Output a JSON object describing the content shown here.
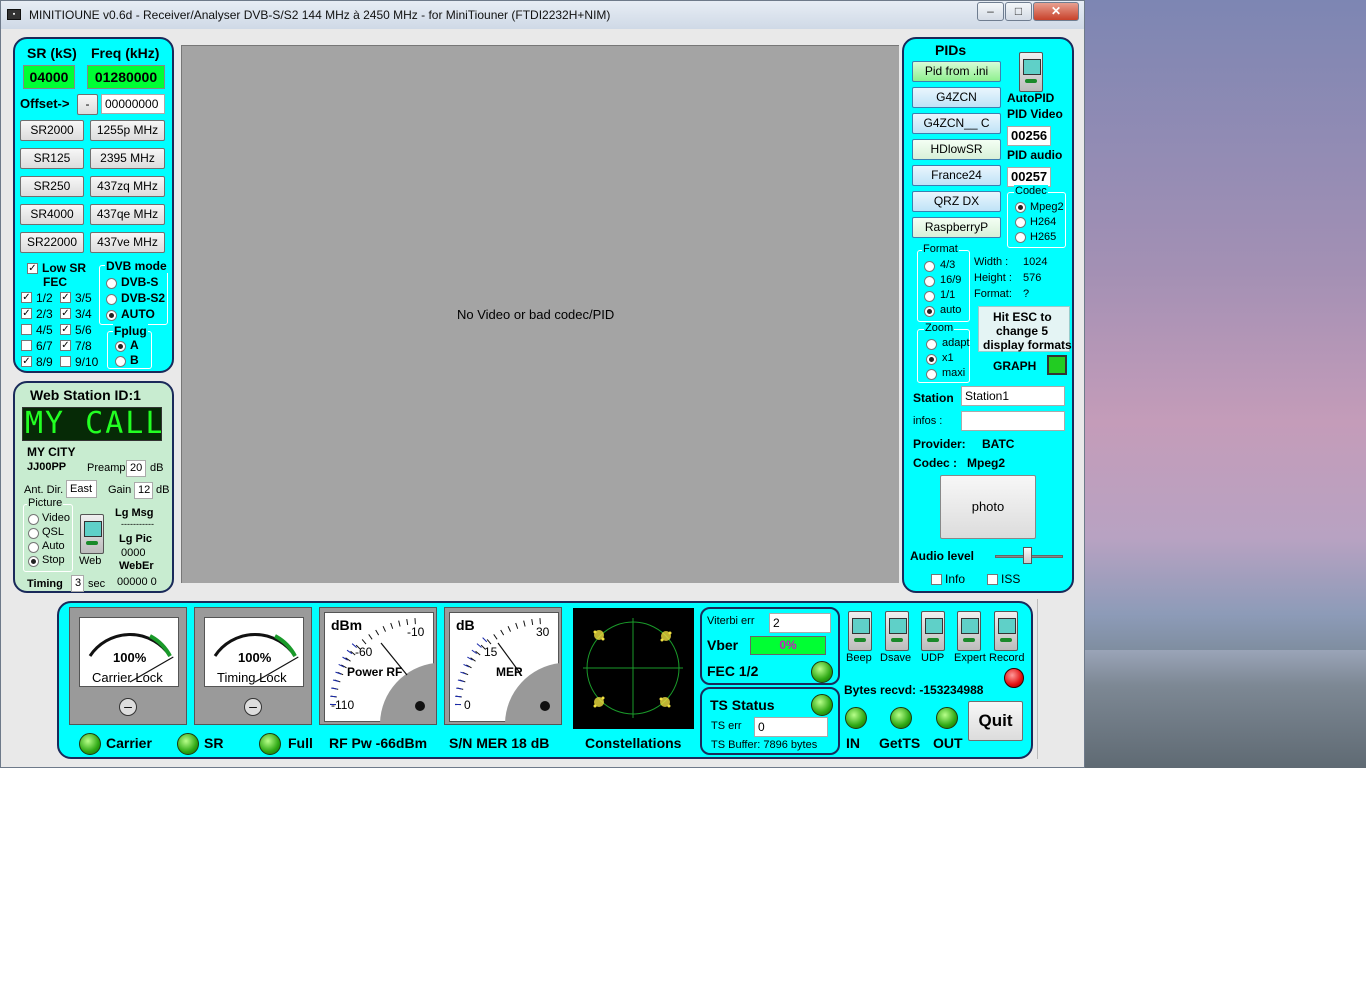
{
  "window": {
    "title": "MINITIOUNE v0.6d - Receiver/Analyser DVB-S/S2 144 MHz à 2450 MHz - for MiniTiouner (FTDI2232H+NIM)"
  },
  "left": {
    "sr_label": "SR (kS)",
    "freq_label": "Freq (kHz)",
    "sr_value": "04000",
    "freq_value": "01280000",
    "offset_label": "Offset->",
    "offset_sign": "-",
    "offset_value": "00000000",
    "sr_buttons": [
      "SR2000",
      "SR125",
      "SR250",
      "SR4000",
      "SR22000"
    ],
    "freq_buttons": [
      "1255p MHz",
      "2395 MHz",
      "437zq MHz",
      "437qe MHz",
      "437ve MHz"
    ],
    "low_sr": "Low SR",
    "fec_label": "FEC",
    "fec": [
      "1/2",
      "3/5",
      "2/3",
      "3/4",
      "4/5",
      "5/6",
      "6/7",
      "7/8",
      "8/9",
      "9/10"
    ],
    "dvb_mode_label": "DVB mode",
    "dvb_modes": [
      "DVB-S",
      "DVB-S2",
      "AUTO"
    ],
    "fplug_label": "Fplug",
    "fplug": [
      "A",
      "B"
    ]
  },
  "web": {
    "title": "Web Station ID:1",
    "lcd": "MY CALL",
    "city": "MY CITY",
    "locator": "JJ00PP",
    "preamp_label": "Preamp",
    "preamp_value": "20",
    "db1": "dB",
    "antdir_label": "Ant. Dir.",
    "antdir_value": "East",
    "gain_label": "Gain",
    "gain_value": "12",
    "db2": "dB",
    "picture_label": "Picture",
    "picture_opts": [
      "Video",
      "QSL",
      "Auto",
      "Stop"
    ],
    "lg_msg": "Lg Msg",
    "dashes": "-----------",
    "lg_pic": "Lg Pic",
    "lg_pic_value": "0000",
    "web_label": "Web",
    "weber_label": "WebEr",
    "weber_value": "00000  0",
    "timing_label": "Timing",
    "timing_value": "3",
    "sec": "sec"
  },
  "video": {
    "message": "No Video or bad codec/PID"
  },
  "pids": {
    "title": "PIDs",
    "buttons": [
      "Pid from .ini",
      "G4ZCN",
      "G4ZCN__ C",
      "HDlowSR",
      "France24",
      "QRZ DX",
      "RaspberryP"
    ],
    "autopid": "AutoPID",
    "pid_video_label": "PID Video",
    "pid_video": "00256",
    "pid_audio_label": "PID audio",
    "pid_audio": "00257",
    "codec_label": "Codec",
    "codecs": [
      "Mpeg2",
      "H264",
      "H265"
    ],
    "format_label": "Format",
    "formats": [
      "4/3",
      "16/9",
      "1/1",
      "auto"
    ],
    "width_label": "Width :",
    "width_value": "1024",
    "height_label": "Height :",
    "height_value": "576",
    "format_info_label": "Format:",
    "format_info_value": "?",
    "zoom_label": "Zoom",
    "zooms": [
      "adapt",
      "x1",
      "maxi"
    ],
    "esc_hint": [
      "Hit ESC to",
      "change  5",
      "display formats"
    ],
    "graph": "GRAPH",
    "station_label": "Station",
    "station_value": "Station1",
    "infos_label": "infos :",
    "infos_value": "",
    "provider_label": "Provider:",
    "provider_value": "BATC",
    "codec_info_label": "Codec :",
    "codec_info_value": "Mpeg2",
    "photo": "photo",
    "audio_level": "Audio level",
    "info": "Info",
    "iss": "ISS"
  },
  "bottom": {
    "carrier_pct": "100%",
    "carrier_lock": "Carrier Lock",
    "timing_pct": "100%",
    "timing_lock": "Timing Lock",
    "carrier_lock_level": 1.0,
    "timing_lock_level": 1.0,
    "rf": {
      "unit": "dBm",
      "ticks": [
        "-10",
        "-60",
        "-110"
      ],
      "caption": "Power RF"
    },
    "mer": {
      "unit": "dB",
      "ticks": [
        "30",
        "15",
        "0"
      ],
      "caption": "MER"
    },
    "labels": {
      "carrier": "Carrier",
      "sr": "SR",
      "full": "Full",
      "rfpw": "RF Pw  -66dBm",
      "snmer": "S/N MER   18 dB",
      "const": "Constellations"
    },
    "viterbi_label": "Viterbi err",
    "viterbi_value": "2",
    "vber_label": "Vber",
    "vber_value": "0%",
    "fec_label": "FEC 1/2",
    "ts_status": "TS Status",
    "ts_err_label": "TS err",
    "ts_err_value": "0",
    "ts_buffer": "TS Buffer: 7896 bytes",
    "toggles": [
      "Beep",
      "Dsave",
      "UDP",
      "Expert",
      "Record"
    ],
    "bytes_recvd": "Bytes recvd:   -153234988",
    "in": "IN",
    "getts": "GetTS",
    "out": "OUT",
    "quit": "Quit"
  }
}
